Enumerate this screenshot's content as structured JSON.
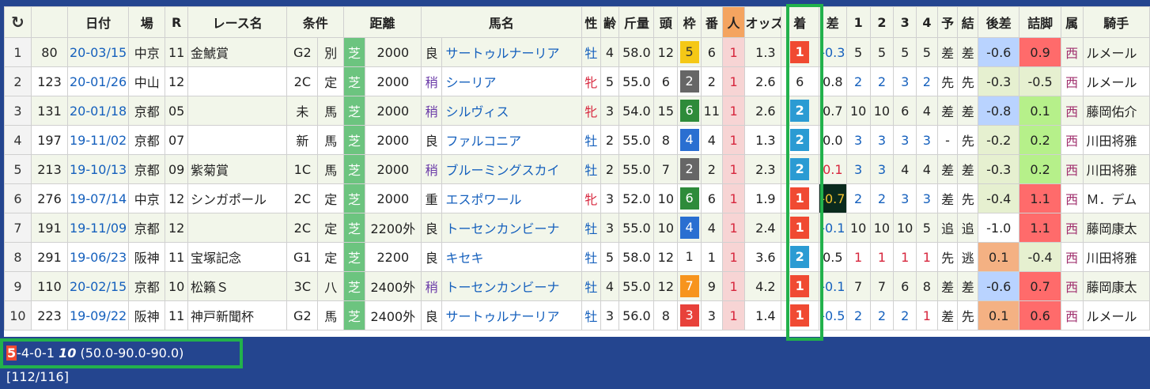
{
  "headers": {
    "reload": "↻",
    "date": "日付",
    "venue": "場",
    "race_no": "R",
    "race_name": "レース名",
    "cond": "条件",
    "distance": "距離",
    "horse": "馬名",
    "sex": "性",
    "age": "齢",
    "weight": "斤量",
    "heads": "頭",
    "waku": "枠",
    "ban": "番",
    "ninki": "人",
    "odds": "オッズ",
    "finish": "着",
    "diff": "差",
    "c1": "1",
    "c2": "2",
    "c3": "3",
    "c4": "4",
    "yoso": "予",
    "result": "結",
    "kosa": "後差",
    "tsume": "詰脚",
    "zoku": "属",
    "jockey": "騎手"
  },
  "rows": [
    {
      "no": "1",
      "id": "80",
      "date": "20-03/15",
      "venue": "中京",
      "r": "11",
      "name": "金鯱賞",
      "grade": "G2",
      "type": "別",
      "surface": "芝",
      "dist": "2000",
      "cond": "良",
      "horse": "サートゥルナーリア",
      "sex": "牡",
      "age": "4",
      "kin": "58.0",
      "heads": "12",
      "waku": "5",
      "wakucolor": "#f5c816",
      "wakutext": "#333",
      "ban": "6",
      "ninki": "1",
      "odds": "1.3",
      "finish": "1",
      "diff": "-0.3",
      "p1": "5",
      "p2": "5",
      "p3": "5",
      "p4": "5",
      "yoso": "差",
      "result": "差",
      "kosa": "-0.6",
      "kosacolor": "#b9d3ff",
      "tsume": "0.9",
      "tsumecolor": "#ff6b6b",
      "zoku": "西",
      "jockey": "ルメール"
    },
    {
      "no": "2",
      "id": "123",
      "date": "20-01/26",
      "venue": "中山",
      "r": "12",
      "name": "",
      "grade": "2C",
      "type": "定",
      "surface": "芝",
      "dist": "2000",
      "cond": "稍",
      "horse": "シーリア",
      "sex": "牝",
      "age": "5",
      "kin": "55.0",
      "heads": "6",
      "waku": "2",
      "wakucolor": "#666666",
      "wakutext": "#fff",
      "ban": "2",
      "ninki": "1",
      "odds": "2.6",
      "finish": "6",
      "diff": "0.8",
      "p1": "2",
      "p2": "2",
      "p3": "3",
      "p4": "2",
      "yoso": "先",
      "result": "先",
      "kosa": "-0.3",
      "kosacolor": "#e6f0d0",
      "tsume": "-0.5",
      "tsumecolor": "#e6f0d0",
      "zoku": "西",
      "jockey": "ルメール"
    },
    {
      "no": "3",
      "id": "131",
      "date": "20-01/18",
      "venue": "京都",
      "r": "05",
      "name": "",
      "grade": "未",
      "type": "馬",
      "surface": "芝",
      "dist": "2000",
      "cond": "稍",
      "horse": "シルヴィス",
      "sex": "牝",
      "age": "3",
      "kin": "54.0",
      "heads": "15",
      "waku": "6",
      "wakucolor": "#2e8b3a",
      "wakutext": "#fff",
      "ban": "11",
      "ninki": "1",
      "odds": "2.6",
      "finish": "2",
      "diff": "0.7",
      "p1": "10",
      "p2": "10",
      "p3": "6",
      "p4": "4",
      "yoso": "差",
      "result": "差",
      "kosa": "-0.8",
      "kosacolor": "#b9d3ff",
      "tsume": "0.1",
      "tsumecolor": "#b6f08a",
      "zoku": "西",
      "jockey": "藤岡佑介"
    },
    {
      "no": "4",
      "id": "197",
      "date": "19-11/02",
      "venue": "京都",
      "r": "07",
      "name": "",
      "grade": "新",
      "type": "馬",
      "surface": "芝",
      "dist": "2000",
      "cond": "良",
      "horse": "ファルコニア",
      "sex": "牡",
      "age": "2",
      "kin": "55.0",
      "heads": "8",
      "waku": "4",
      "wakucolor": "#2a6fd1",
      "wakutext": "#fff",
      "ban": "4",
      "ninki": "1",
      "odds": "1.3",
      "finish": "2",
      "diff": "0.0",
      "p1": "3",
      "p2": "3",
      "p3": "3",
      "p4": "3",
      "yoso": "-",
      "result": "先",
      "kosa": "-0.2",
      "kosacolor": "#e6f0d0",
      "tsume": "0.2",
      "tsumecolor": "#b6f08a",
      "zoku": "西",
      "jockey": "川田将雅"
    },
    {
      "no": "5",
      "id": "213",
      "date": "19-10/13",
      "venue": "京都",
      "r": "09",
      "name": "紫菊賞",
      "grade": "1C",
      "type": "馬",
      "surface": "芝",
      "dist": "2000",
      "cond": "稍",
      "horse": "ブルーミングスカイ",
      "sex": "牡",
      "age": "2",
      "kin": "55.0",
      "heads": "7",
      "waku": "2",
      "wakucolor": "#666666",
      "wakutext": "#fff",
      "ban": "2",
      "ninki": "1",
      "odds": "2.3",
      "finish": "2",
      "diff": "0.1",
      "p1": "3",
      "p2": "3",
      "p3": "4",
      "p4": "4",
      "yoso": "差",
      "result": "差",
      "kosa": "-0.3",
      "kosacolor": "#e6f0d0",
      "tsume": "0.2",
      "tsumecolor": "#b6f08a",
      "zoku": "西",
      "jockey": "川田将雅"
    },
    {
      "no": "6",
      "id": "276",
      "date": "19-07/14",
      "venue": "中京",
      "r": "12",
      "name": "シンガポール",
      "grade": "2C",
      "type": "定",
      "surface": "芝",
      "dist": "2000",
      "cond": "重",
      "horse": "エスポワール",
      "sex": "牝",
      "age": "3",
      "kin": "52.0",
      "heads": "10",
      "waku": "6",
      "wakucolor": "#2e8b3a",
      "wakutext": "#fff",
      "ban": "6",
      "ninki": "1",
      "odds": "1.9",
      "finish": "1",
      "diff": "-0.7",
      "p1": "2",
      "p2": "2",
      "p3": "3",
      "p4": "3",
      "yoso": "差",
      "result": "先",
      "kosa": "-0.4",
      "kosacolor": "#e6f0d0",
      "tsume": "1.1",
      "tsumecolor": "#ff6b6b",
      "zoku": "西",
      "jockey": "Ｍ．デム"
    },
    {
      "no": "7",
      "id": "191",
      "date": "19-11/09",
      "venue": "京都",
      "r": "12",
      "name": "",
      "grade": "2C",
      "type": "定",
      "surface": "芝",
      "dist": "2200外",
      "cond": "良",
      "horse": "トーセンカンビーナ",
      "sex": "牡",
      "age": "3",
      "kin": "55.0",
      "heads": "10",
      "waku": "4",
      "wakucolor": "#2a6fd1",
      "wakutext": "#fff",
      "ban": "4",
      "ninki": "1",
      "odds": "2.4",
      "finish": "1",
      "diff": "-0.1",
      "p1": "10",
      "p2": "10",
      "p3": "10",
      "p4": "5",
      "yoso": "追",
      "result": "追",
      "kosa": "-1.0",
      "kosacolor": "#ffffff",
      "tsume": "1.1",
      "tsumecolor": "#ff6b6b",
      "zoku": "西",
      "jockey": "藤岡康太"
    },
    {
      "no": "8",
      "id": "291",
      "date": "19-06/23",
      "venue": "阪神",
      "r": "11",
      "name": "宝塚記念",
      "grade": "G1",
      "type": "定",
      "surface": "芝",
      "dist": "2200",
      "cond": "良",
      "horse": "キセキ",
      "sex": "牡",
      "age": "5",
      "kin": "58.0",
      "heads": "12",
      "waku": "1",
      "wakucolor": "#ffffff",
      "wakutext": "#333",
      "ban": "1",
      "ninki": "1",
      "odds": "3.6",
      "finish": "2",
      "diff": "0.5",
      "p1": "1",
      "p2": "1",
      "p3": "1",
      "p4": "1",
      "yoso": "先",
      "result": "逃",
      "kosa": "0.1",
      "kosacolor": "#f4b183",
      "tsume": "-0.4",
      "tsumecolor": "#e6f0d0",
      "zoku": "西",
      "jockey": "川田将雅"
    },
    {
      "no": "9",
      "id": "110",
      "date": "20-02/15",
      "venue": "京都",
      "r": "10",
      "name": "松籟Ｓ",
      "grade": "3C",
      "type": "八",
      "surface": "芝",
      "dist": "2400外",
      "cond": "稍",
      "horse": "トーセンカンビーナ",
      "sex": "牡",
      "age": "4",
      "kin": "55.0",
      "heads": "12",
      "waku": "7",
      "wakucolor": "#f7941d",
      "wakutext": "#fff",
      "ban": "9",
      "ninki": "1",
      "odds": "4.2",
      "finish": "1",
      "diff": "-0.1",
      "p1": "7",
      "p2": "7",
      "p3": "6",
      "p4": "8",
      "yoso": "差",
      "result": "差",
      "kosa": "-0.6",
      "kosacolor": "#b9d3ff",
      "tsume": "0.7",
      "tsumecolor": "#ff6b6b",
      "zoku": "西",
      "jockey": "藤岡康太"
    },
    {
      "no": "10",
      "id": "223",
      "date": "19-09/22",
      "venue": "阪神",
      "r": "11",
      "name": "神戸新聞杯",
      "grade": "G2",
      "type": "馬",
      "surface": "芝",
      "dist": "2400外",
      "cond": "良",
      "horse": "サートゥルナーリア",
      "sex": "牡",
      "age": "3",
      "kin": "56.0",
      "heads": "8",
      "waku": "3",
      "wakucolor": "#e8413a",
      "wakutext": "#fff",
      "ban": "3",
      "ninki": "1",
      "odds": "1.4",
      "finish": "1",
      "diff": "-0.5",
      "p1": "2",
      "p2": "2",
      "p3": "2",
      "p4": "1",
      "yoso": "差",
      "result": "先",
      "kosa": "0.1",
      "kosacolor": "#f4b183",
      "tsume": "0.6",
      "tsumecolor": "#ff6b6b",
      "zoku": "西",
      "jockey": "ルメール"
    }
  ],
  "footer": {
    "wins": "5",
    "rest": "-4-0-1",
    "total": "10",
    "rates": "(50.0-90.0-90.0) [112/116]"
  },
  "colors": {
    "page_bg": "#24458f",
    "highlight": "#22b14c",
    "fin1": "#f04a32",
    "fin2": "#2b9bd3"
  }
}
